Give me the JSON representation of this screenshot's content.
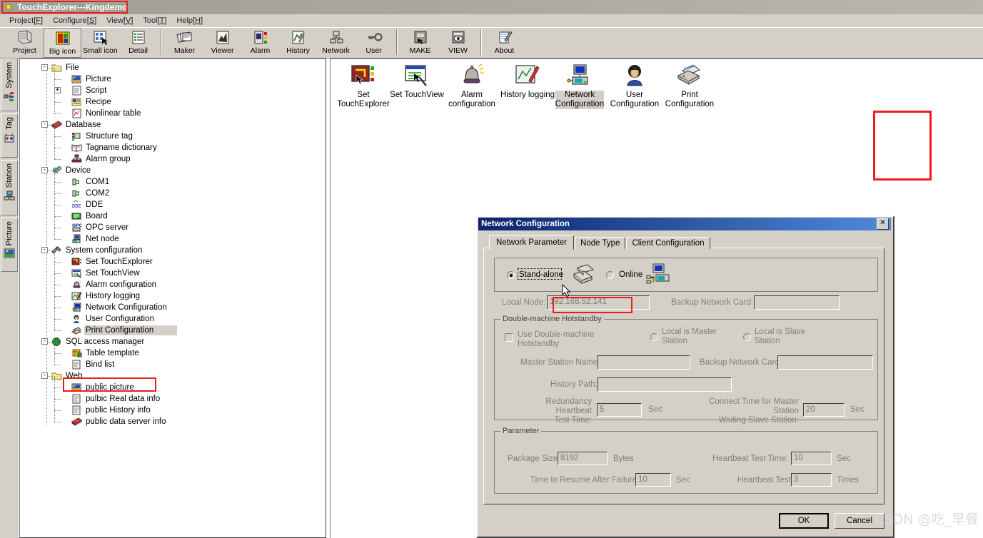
{
  "window": {
    "title": "TouchExplorer---Kingdemo",
    "app_icon": "butterfly-icon"
  },
  "menubar": {
    "items": [
      {
        "label": "Project[",
        "key": "F",
        "tail": "]"
      },
      {
        "label": "Configure[",
        "key": "S",
        "tail": "]"
      },
      {
        "label": "View[",
        "key": "V",
        "tail": "]"
      },
      {
        "label": "Tool[",
        "key": "T",
        "tail": "]"
      },
      {
        "label": "Help[",
        "key": "H",
        "tail": "]"
      }
    ]
  },
  "toolbar": {
    "buttons": [
      {
        "label": "Project",
        "icon": "project-icon",
        "selected": false
      },
      {
        "label": "Big icon",
        "icon": "big-icon-icon",
        "selected": true
      },
      {
        "label": "Small icon",
        "icon": "small-icon-icon",
        "selected": false
      },
      {
        "label": "Detail",
        "icon": "detail-icon",
        "selected": false
      },
      {
        "label": "Maker",
        "icon": "maker-icon",
        "selected": false
      },
      {
        "label": "Viewer",
        "icon": "viewer-icon",
        "selected": false
      },
      {
        "label": "Alarm",
        "icon": "alarm-icon",
        "selected": false
      },
      {
        "label": "History",
        "icon": "history-icon",
        "selected": false
      },
      {
        "label": "Network",
        "icon": "network-icon",
        "selected": false
      },
      {
        "label": "User",
        "icon": "user-key-icon",
        "selected": false
      },
      {
        "label": "MAKE",
        "icon": "make-icon",
        "selected": false
      },
      {
        "label": "VIEW",
        "icon": "view-icon",
        "selected": false
      },
      {
        "label": "About",
        "icon": "about-icon",
        "selected": false
      }
    ]
  },
  "vertical_tabs": [
    {
      "label": "System",
      "icon": "system-tree-icon"
    },
    {
      "label": "Tag",
      "icon": "tag-icon"
    },
    {
      "label": "Station",
      "icon": "station-icon"
    },
    {
      "label": "Picture",
      "icon": "picture-icon"
    }
  ],
  "tree": {
    "nodes": [
      {
        "label": "File",
        "level": 0,
        "expander": "-",
        "icon": "folder-icon"
      },
      {
        "label": "Picture",
        "level": 1,
        "expander": "",
        "icon": "picture-file-icon"
      },
      {
        "label": "Script",
        "level": 1,
        "expander": "+",
        "icon": "script-icon"
      },
      {
        "label": "Recipe",
        "level": 1,
        "expander": "",
        "icon": "recipe-icon"
      },
      {
        "label": "Nonlinear table",
        "level": 1,
        "expander": "",
        "icon": "table-icon"
      },
      {
        "label": "Database",
        "level": 0,
        "expander": "-",
        "icon": "database-icon"
      },
      {
        "label": "Structure tag",
        "level": 1,
        "expander": "",
        "icon": "structure-tag-icon"
      },
      {
        "label": "Tagname dictionary",
        "level": 1,
        "expander": "",
        "icon": "book-icon"
      },
      {
        "label": "Alarm group",
        "level": 1,
        "expander": "",
        "icon": "alarm-group-icon"
      },
      {
        "label": "Device",
        "level": 0,
        "expander": "-",
        "icon": "device-gear-icon"
      },
      {
        "label": "COM1",
        "level": 1,
        "expander": "",
        "icon": "com-port-icon"
      },
      {
        "label": "COM2",
        "level": 1,
        "expander": "",
        "icon": "com-port-icon"
      },
      {
        "label": "DDE",
        "level": 1,
        "expander": "",
        "icon": "dde-icon"
      },
      {
        "label": "Board",
        "level": 1,
        "expander": "",
        "icon": "board-icon"
      },
      {
        "label": "OPC server",
        "level": 1,
        "expander": "",
        "icon": "opc-icon"
      },
      {
        "label": "Net node",
        "level": 1,
        "expander": "",
        "icon": "net-node-icon"
      },
      {
        "label": "System configuration",
        "level": 0,
        "expander": "-",
        "icon": "tools-icon"
      },
      {
        "label": "Set TouchExplorer",
        "level": 1,
        "expander": "",
        "icon": "set-touchexplorer-icon"
      },
      {
        "label": "Set TouchView",
        "level": 1,
        "expander": "",
        "icon": "set-touchview-icon"
      },
      {
        "label": "Alarm configuration",
        "level": 1,
        "expander": "",
        "icon": "bell-icon"
      },
      {
        "label": "History logging",
        "level": 1,
        "expander": "",
        "icon": "history-log-icon"
      },
      {
        "label": "Network Configuration",
        "level": 1,
        "expander": "",
        "icon": "network-conf-icon"
      },
      {
        "label": "User Configuration",
        "level": 1,
        "expander": "",
        "icon": "user-conf-icon"
      },
      {
        "label": "Print Configuration",
        "level": 1,
        "expander": "",
        "icon": "printer-icon",
        "selected": true
      },
      {
        "label": "SQL access manager",
        "level": 0,
        "expander": "-",
        "icon": "globe-icon"
      },
      {
        "label": "Table template",
        "level": 1,
        "expander": "",
        "icon": "table-template-icon"
      },
      {
        "label": "Bind list",
        "level": 1,
        "expander": "",
        "icon": "bind-list-icon"
      },
      {
        "label": "Web",
        "level": 0,
        "expander": "-",
        "icon": "folder-icon"
      },
      {
        "label": "public picture",
        "level": 1,
        "expander": "",
        "icon": "picture-file-icon"
      },
      {
        "label": "pulbic Real data info",
        "level": 1,
        "expander": "",
        "icon": "bind-list-icon"
      },
      {
        "label": "public History info",
        "level": 1,
        "expander": "",
        "icon": "bind-list-icon"
      },
      {
        "label": "public data server info",
        "level": 1,
        "expander": "",
        "icon": "database-icon"
      }
    ]
  },
  "icon_panel": {
    "items": [
      {
        "label": "Set\nTouchExplorer",
        "icon": "set-touchexplorer-icon",
        "selected": false
      },
      {
        "label": "Set TouchView",
        "icon": "set-touchview-icon",
        "selected": false
      },
      {
        "label": "Alarm\nconfiguration",
        "icon": "bell-icon",
        "selected": false
      },
      {
        "label": "History logging",
        "icon": "history-log-icon",
        "selected": false
      },
      {
        "label": "Network\nConfiguration",
        "icon": "network-conf-icon",
        "selected": true
      },
      {
        "label": "User\nConfiguration",
        "icon": "user-conf-icon",
        "selected": false
      },
      {
        "label": "Print\nConfiguration",
        "icon": "printer-icon",
        "selected": false
      }
    ]
  },
  "dialog": {
    "title": "Network Configuration",
    "close_label": "✕",
    "tabs": [
      {
        "label": "Network Parameter",
        "active": true
      },
      {
        "label": "Node Type",
        "active": false
      },
      {
        "label": "Client Configuration",
        "active": false
      }
    ],
    "mode": {
      "standalone_label": "Stand-alone",
      "standalone_checked": true,
      "online_label": "Online",
      "online_checked": false,
      "standalone_icon": "printer-stack-icon",
      "online_icon": "networked-computer-icon"
    },
    "local_node_label": "Local Node:",
    "local_node_value": "192.168.52.141",
    "backup_network_card_label": "Backup Network Card:",
    "backup_network_card_value": "",
    "hotstandby": {
      "group_title": "Double-machine Hotstandby",
      "use_checkbox_label": "Use Double-machine\nHotstandby",
      "use_checked": false,
      "local_master_label": "Local is Master\nStation",
      "local_master_checked": false,
      "local_slave_label": "Local is Slave\nStation",
      "local_slave_checked": false,
      "master_station_name_label": "Master Station Name:",
      "master_station_name_value": "",
      "backup_network_card_label": "Backup Network Card:",
      "backup_network_card_value": "",
      "history_path_label": "History Path:",
      "history_path_value": "",
      "redundancy_heartbeat_label": "Redundancy Heartbeat\nTest Time:",
      "redundancy_heartbeat_value": "5",
      "redundancy_heartbeat_unit": "Sec",
      "connect_time_label": "Connect Time for Master Station\nWaiting Slave Station:",
      "connect_time_value": "20",
      "connect_time_unit": "Sec"
    },
    "parameter": {
      "group_title": "Parameter",
      "package_size_label": "Package Size:",
      "package_size_value": "8192",
      "package_size_unit": "Bytes",
      "heartbeat_test_time_label": "Heartbeat Test Time:",
      "heartbeat_test_time_value": "10",
      "heartbeat_test_time_unit": "Sec",
      "resume_time_label": "Time to Resume After Failure:",
      "resume_time_value": "10",
      "resume_time_unit": "Sec",
      "heartbeat_test_label": "Heartbeat Test:",
      "heartbeat_test_value": "3",
      "heartbeat_test_unit": "Times"
    },
    "ok_label": "OK",
    "cancel_label": "Cancel"
  },
  "watermark": "CSDN @吃_早餐",
  "colors": {
    "face": "#d4d0c8",
    "highlight_red": "#ee1c1c",
    "dialog_title_start": "#0a246a",
    "dialog_title_end": "#4f8adc",
    "window_title_bar": "#9d9d94"
  }
}
